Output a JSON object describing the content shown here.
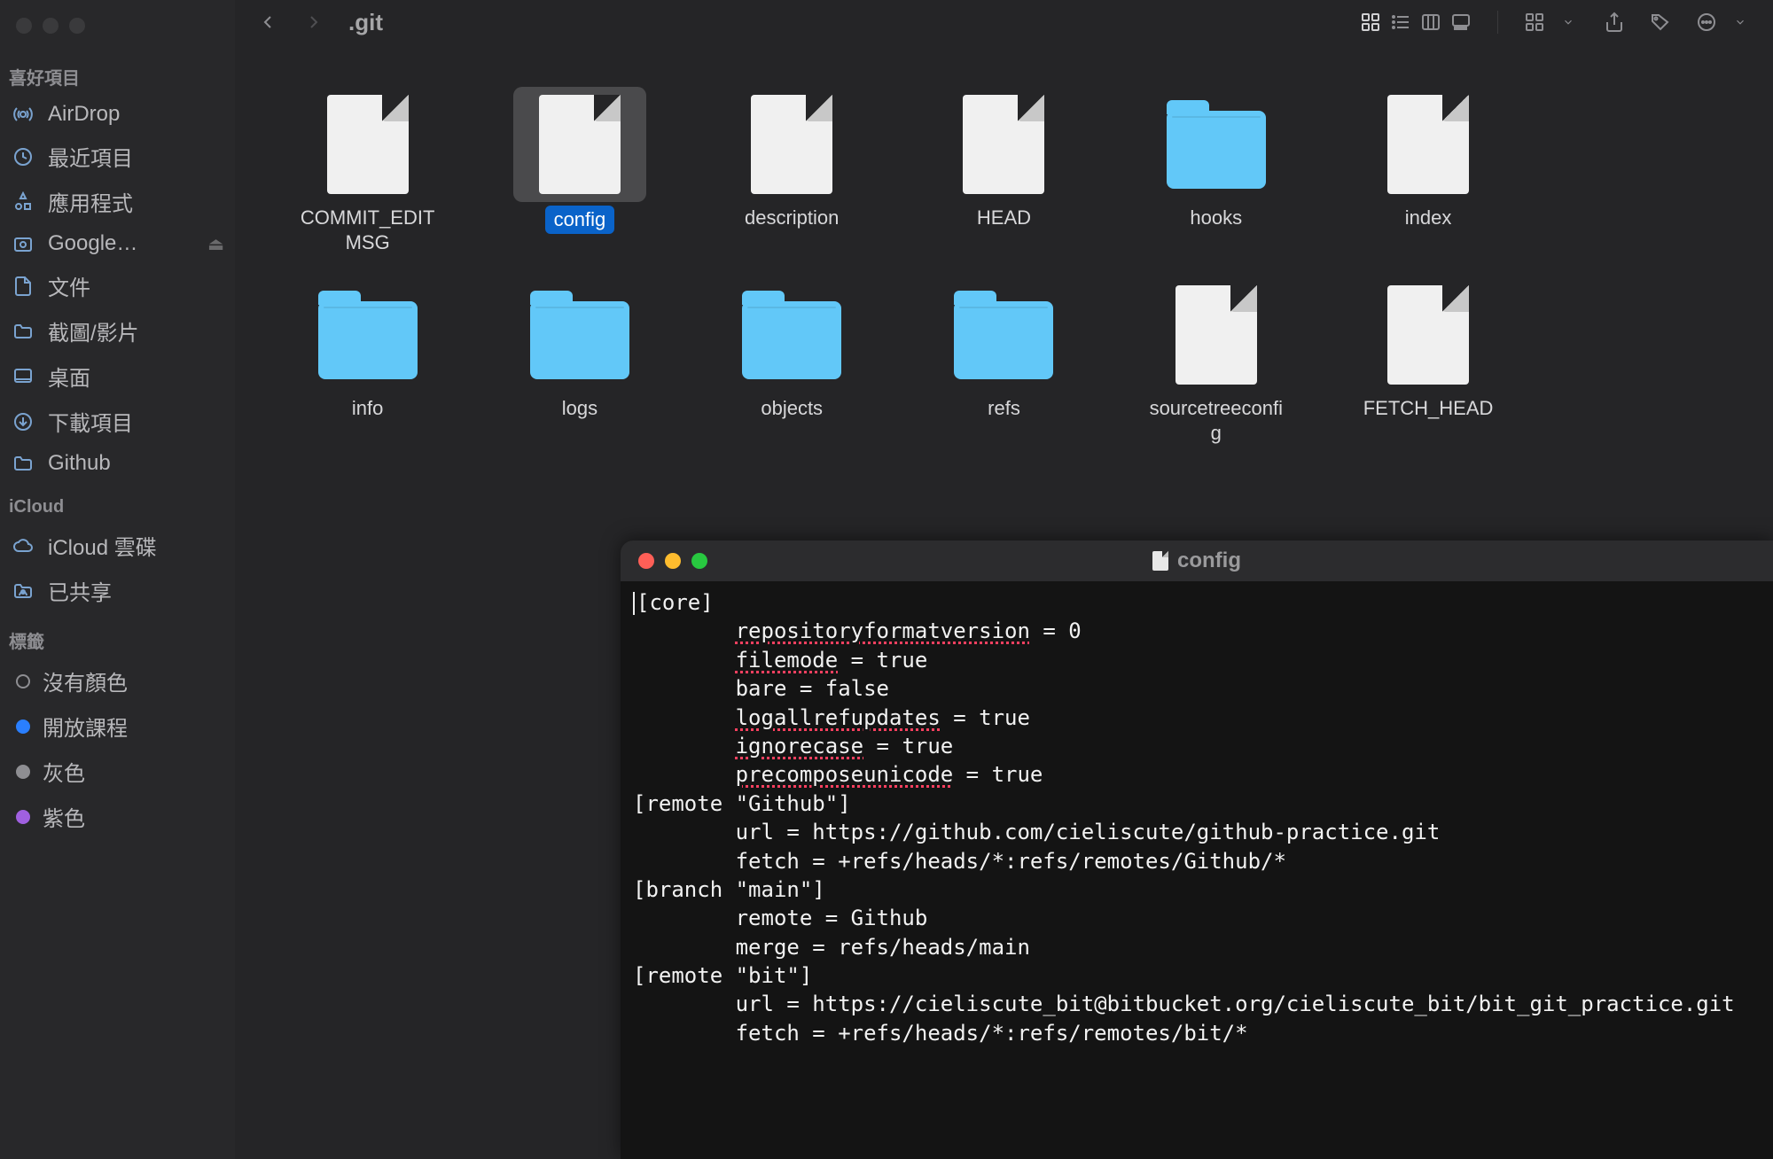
{
  "sidebar": {
    "sections": {
      "favorites": {
        "title": "喜好項目",
        "items": [
          {
            "icon": "airdrop",
            "label": "AirDrop"
          },
          {
            "icon": "clock",
            "label": "最近項目"
          },
          {
            "icon": "apps",
            "label": "應用程式"
          },
          {
            "icon": "gdrive",
            "label": "Google…",
            "ejectable": true
          },
          {
            "icon": "doc",
            "label": "文件"
          },
          {
            "icon": "folder",
            "label": "截圖/影片"
          },
          {
            "icon": "desktop",
            "label": "桌面"
          },
          {
            "icon": "download",
            "label": "下載項目"
          },
          {
            "icon": "folder",
            "label": "Github"
          }
        ]
      },
      "icloud": {
        "title": "iCloud",
        "items": [
          {
            "icon": "cloud",
            "label": "iCloud 雲碟"
          },
          {
            "icon": "shared",
            "label": "已共享"
          }
        ]
      },
      "tags": {
        "title": "標籤",
        "items": [
          {
            "color": "none",
            "label": "沒有顏色"
          },
          {
            "color": "blue",
            "label": "開放課程"
          },
          {
            "color": "gray",
            "label": "灰色"
          },
          {
            "color": "purple",
            "label": "紫色"
          }
        ]
      }
    }
  },
  "toolbar": {
    "title": ".git"
  },
  "grid": {
    "items": [
      {
        "type": "file",
        "label": "COMMIT_EDITMSG"
      },
      {
        "type": "file",
        "label": "config",
        "selected": true
      },
      {
        "type": "file",
        "label": "description"
      },
      {
        "type": "file",
        "label": "HEAD"
      },
      {
        "type": "folder",
        "label": "hooks"
      },
      {
        "type": "file",
        "label": "index"
      },
      {
        "type": "folder",
        "label": "info"
      },
      {
        "type": "folder",
        "label": "logs"
      },
      {
        "type": "folder",
        "label": "objects"
      },
      {
        "type": "folder",
        "label": "refs"
      },
      {
        "type": "file",
        "label": "sourcetreeconfig"
      },
      {
        "type": "file",
        "label": "FETCH_HEAD"
      }
    ]
  },
  "editor": {
    "title": "config",
    "lines": [
      {
        "indent": 0,
        "seg": [
          {
            "t": "[core]"
          }
        ]
      },
      {
        "indent": 1,
        "seg": [
          {
            "t": "repositoryformatversion",
            "sq": true
          },
          {
            "t": " = 0"
          }
        ]
      },
      {
        "indent": 1,
        "seg": [
          {
            "t": "filemode",
            "sq": true
          },
          {
            "t": " = true"
          }
        ]
      },
      {
        "indent": 1,
        "seg": [
          {
            "t": "bare = false"
          }
        ]
      },
      {
        "indent": 1,
        "seg": [
          {
            "t": "logallrefupdates",
            "sq": true
          },
          {
            "t": " = true"
          }
        ]
      },
      {
        "indent": 1,
        "seg": [
          {
            "t": "ignorecase",
            "sq": true
          },
          {
            "t": " = true"
          }
        ]
      },
      {
        "indent": 1,
        "seg": [
          {
            "t": "precomposeunicode",
            "sq": true
          },
          {
            "t": " = true"
          }
        ]
      },
      {
        "indent": 0,
        "seg": [
          {
            "t": "[remote \"Github\"]"
          }
        ]
      },
      {
        "indent": 1,
        "seg": [
          {
            "t": "url = https://github.com/cieliscute/github-practice.git"
          }
        ]
      },
      {
        "indent": 1,
        "seg": [
          {
            "t": "fetch = +refs/heads/*:refs/remotes/Github/*"
          }
        ]
      },
      {
        "indent": 0,
        "seg": [
          {
            "t": "[branch \"main\"]"
          }
        ]
      },
      {
        "indent": 1,
        "seg": [
          {
            "t": "remote = Github"
          }
        ]
      },
      {
        "indent": 1,
        "seg": [
          {
            "t": "merge = refs/heads/main"
          }
        ]
      },
      {
        "indent": 0,
        "seg": [
          {
            "t": "[remote \"bit\"]"
          }
        ]
      },
      {
        "indent": 1,
        "seg": [
          {
            "t": "url = https://cieliscute_bit@bitbucket.org/cieliscute_bit/bit_git_practice.git"
          }
        ]
      },
      {
        "indent": 1,
        "seg": [
          {
            "t": "fetch = +refs/heads/*:refs/remotes/bit/*"
          }
        ]
      }
    ]
  }
}
